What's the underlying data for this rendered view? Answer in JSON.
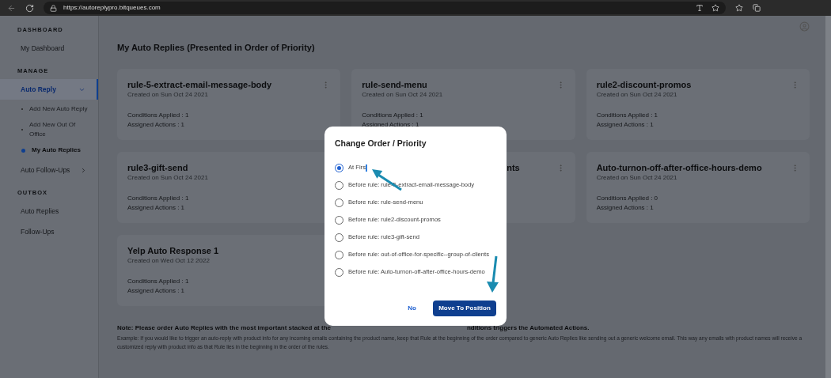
{
  "browser": {
    "url": "https://autoreplypro.bitqueues.com"
  },
  "sidebar": {
    "sections": [
      {
        "heading": "DASHBOARD",
        "items": [
          {
            "label": "My Dashboard",
            "selected": false
          }
        ]
      },
      {
        "heading": "MANAGE",
        "items": [
          {
            "label": "Auto Reply",
            "selected": true,
            "expanded": true,
            "children": [
              {
                "label": "Add New Auto Reply",
                "selected": false
              },
              {
                "label": "Add New Out Of Office",
                "selected": false
              },
              {
                "label": "My Auto Replies",
                "selected": true
              }
            ]
          },
          {
            "label": "Auto Follow-Ups",
            "selected": false,
            "expanded": false
          }
        ]
      },
      {
        "heading": "OUTBOX",
        "items": [
          {
            "label": "Auto Replies",
            "selected": false
          },
          {
            "label": "Follow-Ups",
            "selected": false
          }
        ]
      }
    ]
  },
  "page": {
    "title": "My Auto Replies (Presented in Order of Priority)",
    "cards": [
      {
        "kind": "full",
        "title": "rule-5-extract-email-message-body",
        "date": "Created on Sun Oct 24 2021",
        "conditions": "Conditions Applied : 1",
        "actions": "Assigned Actions : 1"
      },
      {
        "kind": "full",
        "title": "rule-send-menu",
        "date": "Created on Sun Oct 24 2021",
        "conditions": "Conditions Applied : 1",
        "actions": "Assigned Actions : 1"
      },
      {
        "kind": "full",
        "title": "rule2-discount-promos",
        "date": "Created on Sun Oct 24 2021",
        "conditions": "Conditions Applied : 1",
        "actions": "Assigned Actions : 1"
      },
      {
        "kind": "full",
        "title": "rule3-gift-send",
        "date": "Created on Sun Oct 24 2021",
        "conditions": "Conditions Applied : 1",
        "actions": "Assigned Actions : 1"
      },
      {
        "kind": "partial",
        "title": "nts"
      },
      {
        "kind": "full",
        "title": "Auto-turnon-off-after-office-hours-demo",
        "date": "Created on Sun Oct 24 2021",
        "conditions": "Conditions Applied : 0",
        "actions": "Assigned Actions : 1"
      },
      {
        "kind": "full",
        "title": "Yelp Auto Response 1",
        "date": "Created on Wed Oct 12 2022",
        "conditions": "Conditions Applied : 1",
        "actions": "Assigned Actions : 1"
      }
    ],
    "note_start": "Note: Please order Auto Replies with the most important stacked at the",
    "note_end": "nditions triggers the Automated Actions.",
    "example": "Example: If you would like to trigger an auto-reply with product info for any incoming emails containing the product name, keep that Rule at the beginning of the order compared to generic Auto Replies like sending out a generic welcome email. This way any emails with product names will receive a customized reply with product info as that Rule lies in the beginning in the order of the rules."
  },
  "modal": {
    "title": "Change Order / Priority",
    "options": [
      {
        "label": "At Firs",
        "selected": true
      },
      {
        "label": "Before rule: rule-5-extract-email-message-body",
        "selected": false
      },
      {
        "label": "Before rule: rule-send-menu",
        "selected": false
      },
      {
        "label": "Before rule: rule2-discount-promos",
        "selected": false
      },
      {
        "label": "Before rule: rule3-gift-send",
        "selected": false
      },
      {
        "label": "Before rule: out-of-office-for-specific--group-of-clients",
        "selected": false
      },
      {
        "label": "Before rule: Auto-turnon-off-after-office-hours-demo",
        "selected": false
      }
    ],
    "cancel": "No",
    "confirm": "Move To Position"
  }
}
